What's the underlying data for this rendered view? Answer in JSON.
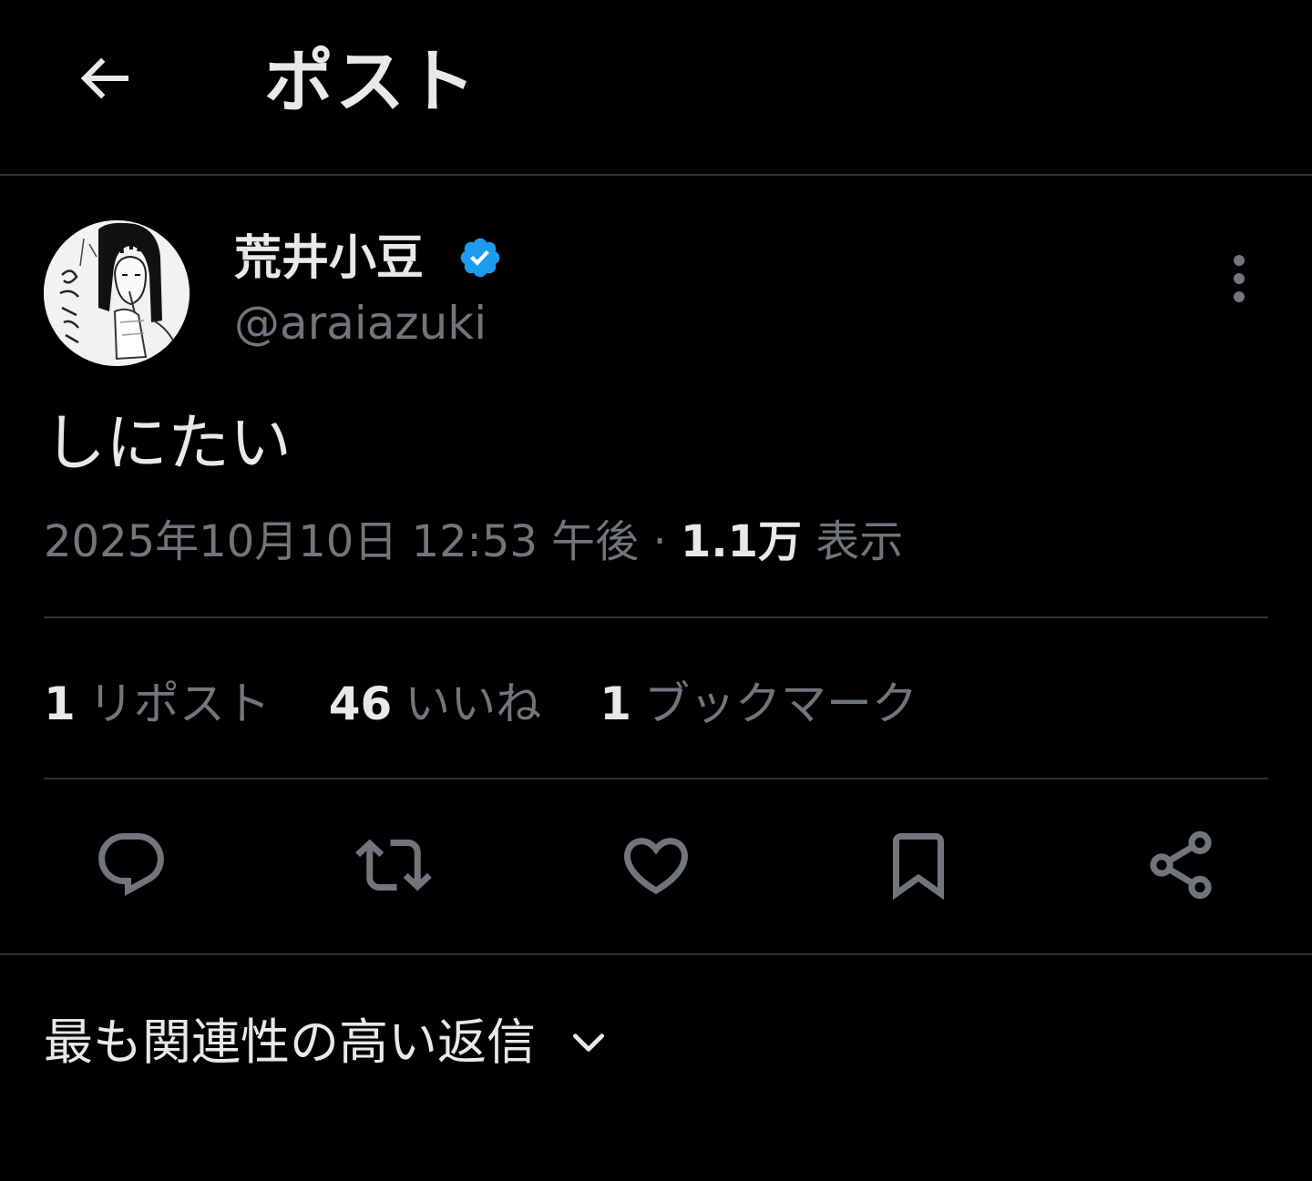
{
  "header": {
    "title": "ポスト",
    "back_icon": "arrow-left-icon"
  },
  "author": {
    "name": "荒井小豆",
    "handle": "@araiazuki",
    "verified": true,
    "verified_color": "#1d9bf0"
  },
  "post": {
    "text": "しにたい",
    "timestamp": "2025年10月10日 12:53 午後",
    "separator": "·",
    "views_count": "1.1万",
    "views_label": "表示"
  },
  "stats": {
    "reposts_count": "1",
    "reposts_label": "リポスト",
    "likes_count": "46",
    "likes_label": "いいね",
    "bookmarks_count": "1",
    "bookmarks_label": "ブックマーク"
  },
  "actions": [
    {
      "icon": "reply-icon"
    },
    {
      "icon": "repost-icon"
    },
    {
      "icon": "heart-icon"
    },
    {
      "icon": "bookmark-icon"
    },
    {
      "icon": "share-icon"
    }
  ],
  "replies": {
    "sort_label": "最も関連性の高い返信",
    "chevron_icon": "chevron-down-icon"
  },
  "colors": {
    "background": "#000000",
    "primary_text": "#e7e9ea",
    "secondary_text": "#71767b",
    "divider": "#2f3336",
    "accent": "#1d9bf0"
  }
}
